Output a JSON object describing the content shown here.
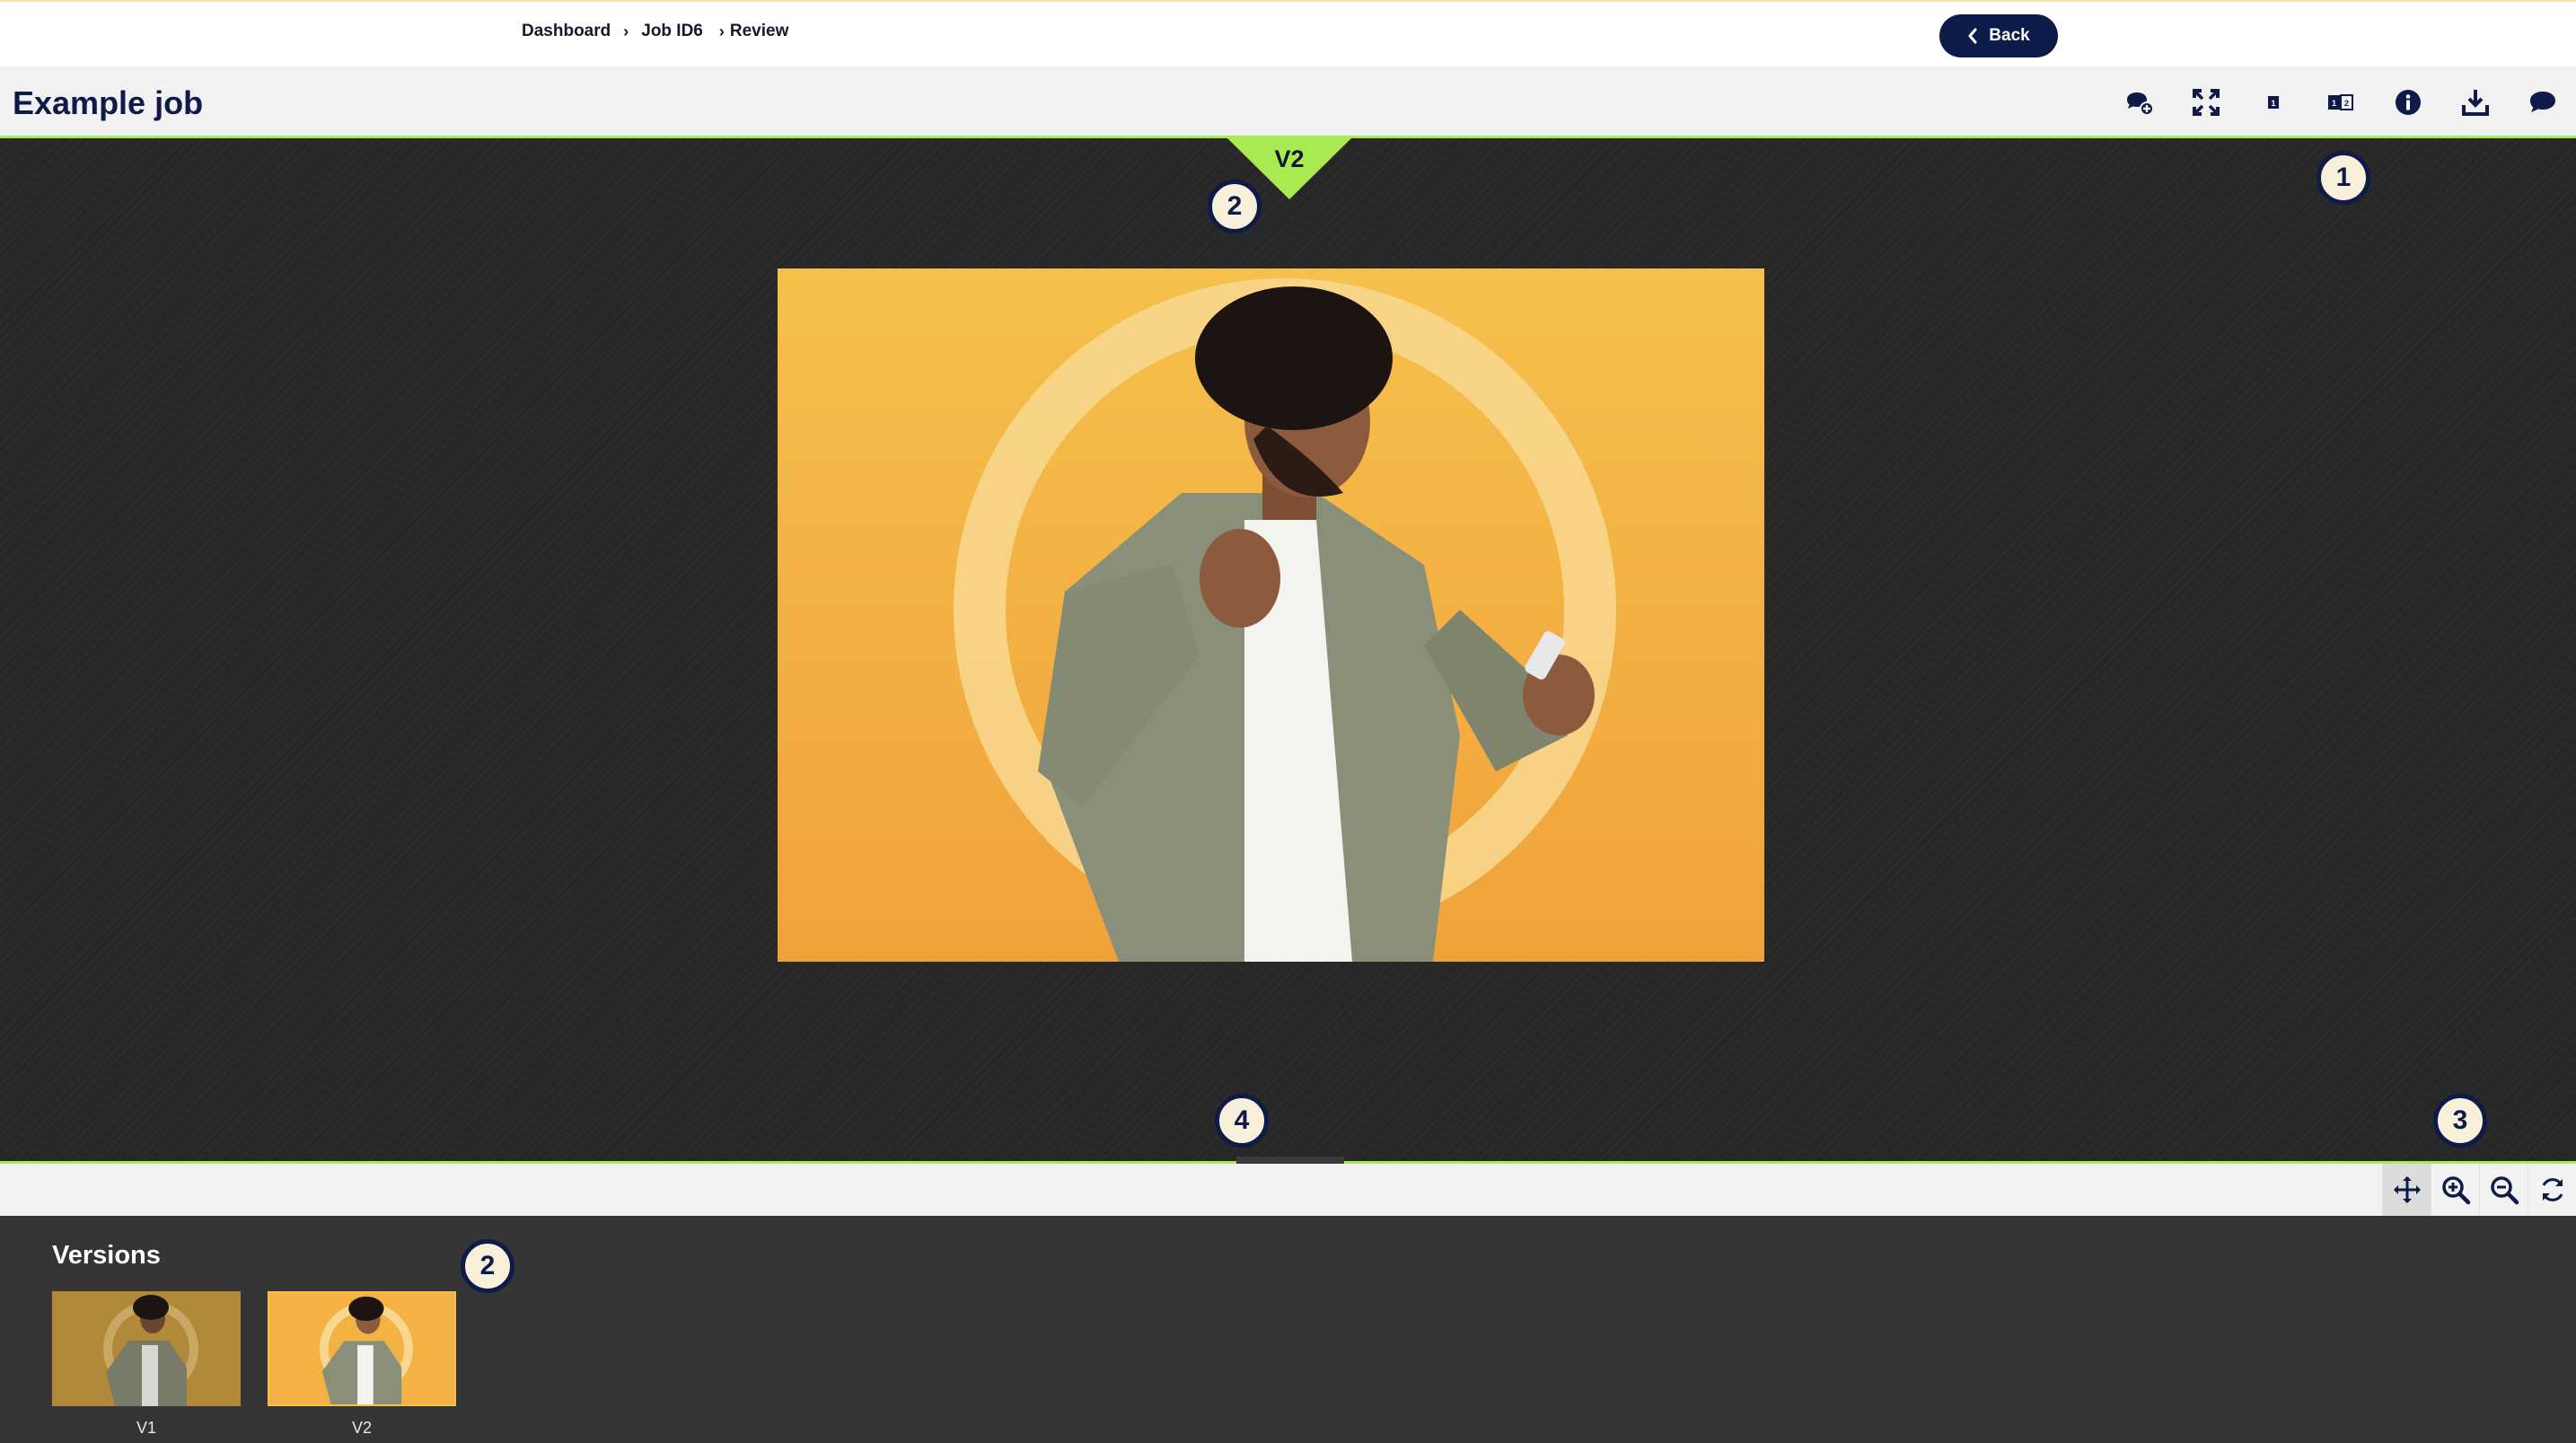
{
  "breadcrumb": {
    "items": [
      "Dashboard",
      "Job ID6",
      "Review"
    ],
    "separator": "›"
  },
  "top_actions": {
    "back_label": "Back"
  },
  "header": {
    "title": "Example job"
  },
  "toolbar": {
    "items": [
      {
        "name": "add-comment-icon"
      },
      {
        "name": "fullscreen-icon"
      },
      {
        "name": "single-view-icon"
      },
      {
        "name": "compare-view-icon"
      },
      {
        "name": "info-icon"
      },
      {
        "name": "download-icon"
      },
      {
        "name": "comments-icon"
      }
    ]
  },
  "viewer": {
    "current_version": "V2"
  },
  "markers": {
    "m1": "1",
    "m2_top": "2",
    "m3": "3",
    "m4": "4",
    "m2_bottom": "2"
  },
  "controls": {
    "items": [
      "move-icon",
      "zoom-in-icon",
      "zoom-out-icon",
      "reset-icon"
    ]
  },
  "versions": {
    "title": "Versions",
    "items": [
      {
        "label": "V1"
      },
      {
        "label": "V2"
      }
    ]
  },
  "colors": {
    "navy": "#0e1a47",
    "accent_green": "#a7ea52",
    "canvas": "#272727",
    "panel": "#353535"
  }
}
